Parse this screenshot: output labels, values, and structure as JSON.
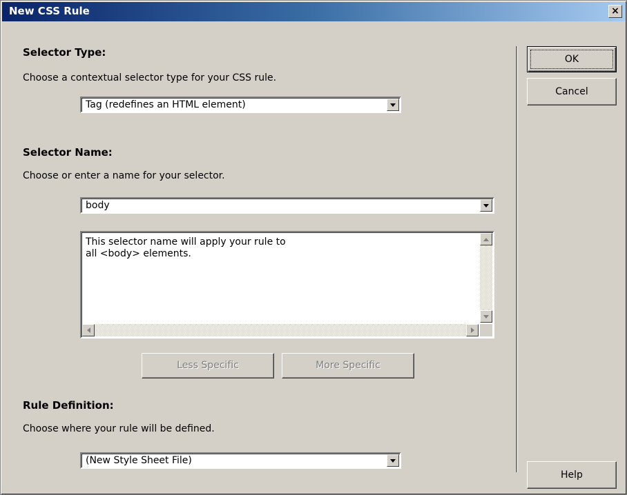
{
  "window": {
    "title": "New CSS Rule",
    "close_glyph": "×"
  },
  "selector_type": {
    "heading": "Selector Type:",
    "description": "Choose a contextual selector type for your CSS rule.",
    "selected": "Tag (redefines an HTML element)"
  },
  "selector_name": {
    "heading": "Selector Name:",
    "description": "Choose or enter a name for your selector.",
    "value": "body",
    "info_text": "This selector name will apply your rule to\nall <body> elements.",
    "less_specific_label": "Less Specific",
    "more_specific_label": "More Specific"
  },
  "rule_definition": {
    "heading": "Rule Definition:",
    "description": "Choose where your rule will be defined.",
    "selected": "(New Style Sheet File)"
  },
  "buttons": {
    "ok_label": "OK",
    "cancel_label": "Cancel",
    "help_label": "Help"
  }
}
